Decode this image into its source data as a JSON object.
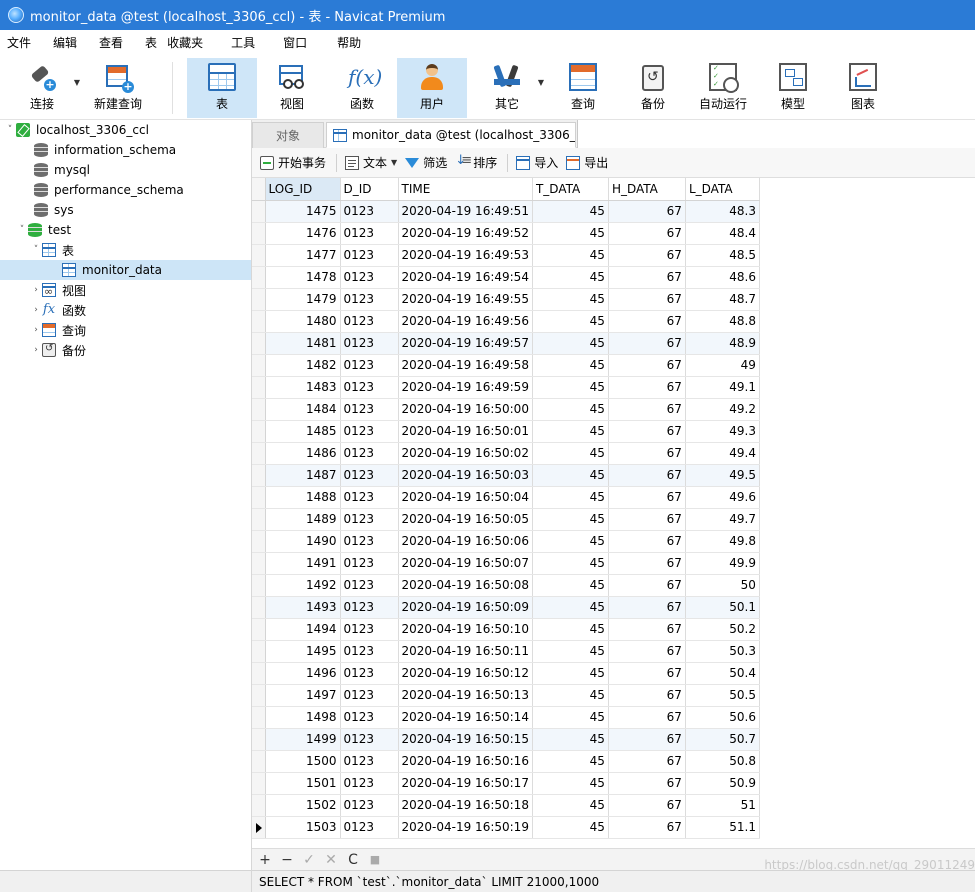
{
  "window": {
    "title": "monitor_data @test (localhost_3306_ccl) - 表 - Navicat Premium"
  },
  "menu": [
    "文件",
    "编辑",
    "查看",
    "表",
    "收藏夹",
    "工具",
    "窗口",
    "帮助"
  ],
  "toolbar": {
    "connect": "连接",
    "new_query": "新建查询",
    "table": "表",
    "view": "视图",
    "function": "函数",
    "user": "用户",
    "other": "其它",
    "query": "查询",
    "backup": "备份",
    "automation": "自动运行",
    "model": "模型",
    "chart": "图表"
  },
  "tree": {
    "connection": "localhost_3306_ccl",
    "databases": [
      "information_schema",
      "mysql",
      "performance_schema",
      "sys"
    ],
    "active_db": "test",
    "tables_folder": "表",
    "table": "monitor_data",
    "views": "视图",
    "functions": "函数",
    "queries": "查询",
    "backups": "备份"
  },
  "tabs": {
    "objects": "对象",
    "active": "monitor_data @test (localhost_3306_..."
  },
  "subtoolbar": {
    "begin_tx": "开始事务",
    "text": "文本",
    "filter": "筛选",
    "sort": "排序",
    "import": "导入",
    "export": "导出"
  },
  "grid": {
    "columns": [
      "LOG_ID",
      "D_ID",
      "TIME",
      "T_DATA",
      "H_DATA",
      "L_DATA"
    ],
    "rows": [
      [
        "1475",
        "0123",
        "2020-04-19 16:49:51",
        "45",
        "67",
        "48.3"
      ],
      [
        "1476",
        "0123",
        "2020-04-19 16:49:52",
        "45",
        "67",
        "48.4"
      ],
      [
        "1477",
        "0123",
        "2020-04-19 16:49:53",
        "45",
        "67",
        "48.5"
      ],
      [
        "1478",
        "0123",
        "2020-04-19 16:49:54",
        "45",
        "67",
        "48.6"
      ],
      [
        "1479",
        "0123",
        "2020-04-19 16:49:55",
        "45",
        "67",
        "48.7"
      ],
      [
        "1480",
        "0123",
        "2020-04-19 16:49:56",
        "45",
        "67",
        "48.8"
      ],
      [
        "1481",
        "0123",
        "2020-04-19 16:49:57",
        "45",
        "67",
        "48.9"
      ],
      [
        "1482",
        "0123",
        "2020-04-19 16:49:58",
        "45",
        "67",
        "49"
      ],
      [
        "1483",
        "0123",
        "2020-04-19 16:49:59",
        "45",
        "67",
        "49.1"
      ],
      [
        "1484",
        "0123",
        "2020-04-19 16:50:00",
        "45",
        "67",
        "49.2"
      ],
      [
        "1485",
        "0123",
        "2020-04-19 16:50:01",
        "45",
        "67",
        "49.3"
      ],
      [
        "1486",
        "0123",
        "2020-04-19 16:50:02",
        "45",
        "67",
        "49.4"
      ],
      [
        "1487",
        "0123",
        "2020-04-19 16:50:03",
        "45",
        "67",
        "49.5"
      ],
      [
        "1488",
        "0123",
        "2020-04-19 16:50:04",
        "45",
        "67",
        "49.6"
      ],
      [
        "1489",
        "0123",
        "2020-04-19 16:50:05",
        "45",
        "67",
        "49.7"
      ],
      [
        "1490",
        "0123",
        "2020-04-19 16:50:06",
        "45",
        "67",
        "49.8"
      ],
      [
        "1491",
        "0123",
        "2020-04-19 16:50:07",
        "45",
        "67",
        "49.9"
      ],
      [
        "1492",
        "0123",
        "2020-04-19 16:50:08",
        "45",
        "67",
        "50"
      ],
      [
        "1493",
        "0123",
        "2020-04-19 16:50:09",
        "45",
        "67",
        "50.1"
      ],
      [
        "1494",
        "0123",
        "2020-04-19 16:50:10",
        "45",
        "67",
        "50.2"
      ],
      [
        "1495",
        "0123",
        "2020-04-19 16:50:11",
        "45",
        "67",
        "50.3"
      ],
      [
        "1496",
        "0123",
        "2020-04-19 16:50:12",
        "45",
        "67",
        "50.4"
      ],
      [
        "1497",
        "0123",
        "2020-04-19 16:50:13",
        "45",
        "67",
        "50.5"
      ],
      [
        "1498",
        "0123",
        "2020-04-19 16:50:14",
        "45",
        "67",
        "50.6"
      ],
      [
        "1499",
        "0123",
        "2020-04-19 16:50:15",
        "45",
        "67",
        "50.7"
      ],
      [
        "1500",
        "0123",
        "2020-04-19 16:50:16",
        "45",
        "67",
        "50.8"
      ],
      [
        "1501",
        "0123",
        "2020-04-19 16:50:17",
        "45",
        "67",
        "50.9"
      ],
      [
        "1502",
        "0123",
        "2020-04-19 16:50:18",
        "45",
        "67",
        "51"
      ],
      [
        "1503",
        "0123",
        "2020-04-19 16:50:19",
        "45",
        "67",
        "51.1"
      ]
    ]
  },
  "nav": {
    "add": "+",
    "remove": "−",
    "apply": "✓",
    "discard": "✕",
    "refresh": "C",
    "stop": "■"
  },
  "status": {
    "sql": "SELECT * FROM `test`.`monitor_data` LIMIT 21000,1000"
  },
  "watermark": "https://blog.csdn.net/qq_29011249"
}
